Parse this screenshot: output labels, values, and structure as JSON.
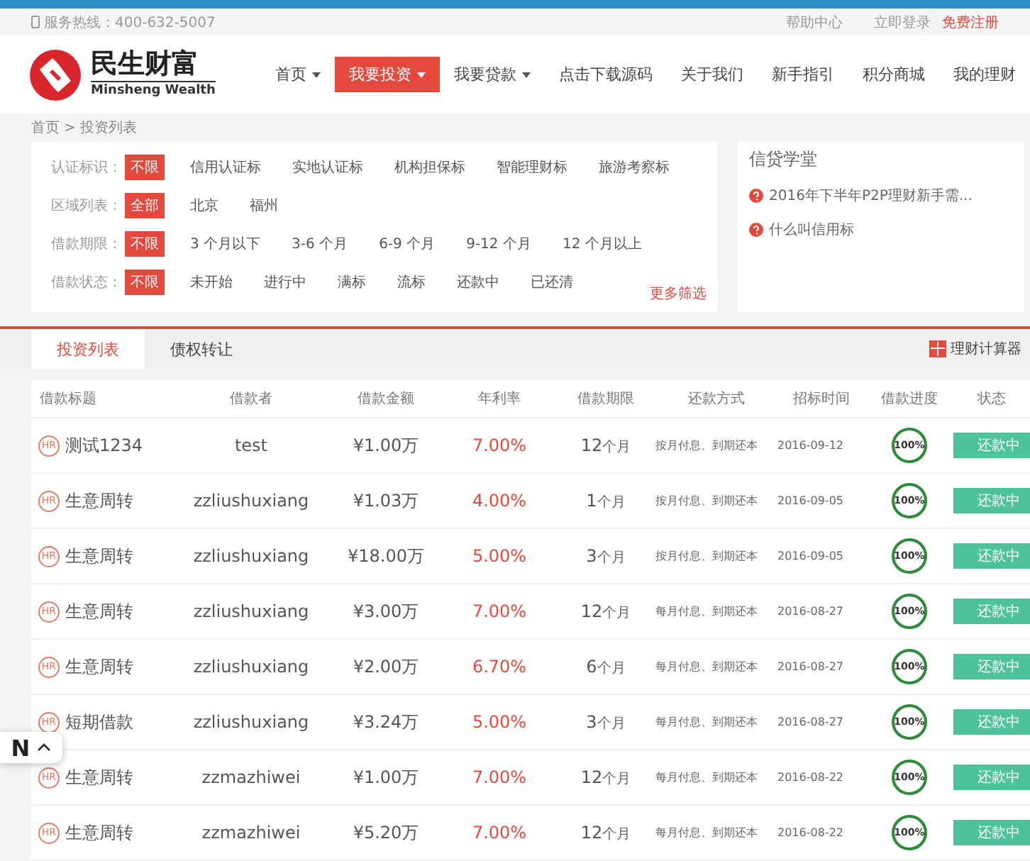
{
  "top_bar": {
    "hotline": "服务热线：400-632-5007",
    "links": [
      {
        "label": "帮助中心",
        "highlight": false
      },
      {
        "label": "立即登录",
        "highlight": false
      },
      {
        "label": "免费注册",
        "highlight": true
      }
    ]
  },
  "logo": {
    "name": "民生财富",
    "subtitle": "Minsheng Wealth"
  },
  "nav": [
    {
      "label": "首页",
      "selected": false,
      "has_menu": true
    },
    {
      "label": "我要投资",
      "selected": true,
      "has_menu": true
    },
    {
      "label": "我要贷款",
      "selected": false,
      "has_menu": true
    },
    {
      "label": "点击下载源码",
      "selected": false,
      "has_menu": false
    },
    {
      "label": "关于我们",
      "selected": false,
      "has_menu": false
    },
    {
      "label": "新手指引",
      "selected": false,
      "has_menu": false
    },
    {
      "label": "积分商城",
      "selected": false,
      "has_menu": false
    },
    {
      "label": "我的理财",
      "selected": false,
      "has_menu": false
    }
  ],
  "breadcrumb": {
    "items": [
      "首页",
      "投资列表"
    ],
    "separator": ">"
  },
  "filters": [
    {
      "label": "认证标识：",
      "options": [
        {
          "label": "不限",
          "selected": true
        },
        {
          "label": "信用认证标",
          "selected": false
        },
        {
          "label": "实地认证标",
          "selected": false
        },
        {
          "label": "机构担保标",
          "selected": false
        },
        {
          "label": "智能理财标",
          "selected": false
        },
        {
          "label": "旅游考察标",
          "selected": false
        }
      ]
    },
    {
      "label": "区域列表：",
      "options": [
        {
          "label": "全部",
          "selected": true
        },
        {
          "label": "北京",
          "selected": false
        },
        {
          "label": "福州",
          "selected": false
        }
      ]
    },
    {
      "label": "借款期限：",
      "options": [
        {
          "label": "不限",
          "selected": true
        },
        {
          "label": "3 个月以下",
          "selected": false
        },
        {
          "label": "3-6 个月",
          "selected": false
        },
        {
          "label": "6-9 个月",
          "selected": false
        },
        {
          "label": "9-12 个月",
          "selected": false
        },
        {
          "label": "12 个月以上",
          "selected": false
        }
      ]
    },
    {
      "label": "借款状态：",
      "options": [
        {
          "label": "不限",
          "selected": true
        },
        {
          "label": "未开始",
          "selected": false
        },
        {
          "label": "进行中",
          "selected": false
        },
        {
          "label": "满标",
          "selected": false
        },
        {
          "label": "流标",
          "selected": false
        },
        {
          "label": "还款中",
          "selected": false
        },
        {
          "label": "已还清",
          "selected": false
        }
      ]
    }
  ],
  "more_filters": "更多筛选",
  "school": {
    "title": "信贷学堂",
    "items": [
      "2016年下半年P2P理财新手需...",
      "什么叫信用标"
    ]
  },
  "tabs": [
    {
      "label": "投资列表",
      "selected": true
    },
    {
      "label": "债权转让",
      "selected": false
    }
  ],
  "calculator": "理财计算器",
  "table": {
    "columns": [
      "借款标题",
      "借款者",
      "借款金额",
      "年利率",
      "借款期限",
      "还款方式",
      "招标时间",
      "借款进度",
      "状态"
    ],
    "rows": [
      {
        "badge": "HR",
        "title": "测试1234",
        "borrower": "test",
        "amount": "¥1.00万",
        "rate": "7.00%",
        "period": "12",
        "unit": "个月",
        "repayment": "按月付息、到期还本",
        "date": "2016-09-12",
        "progress": "100%",
        "level": 1,
        "status": "还款中"
      },
      {
        "badge": "HR",
        "title": "生意周转",
        "borrower": "zzliushuxiang",
        "amount": "¥1.03万",
        "rate": "4.00%",
        "period": "1",
        "unit": "个月",
        "repayment": "按月付息、到期还本",
        "date": "2016-09-05",
        "progress": "100%",
        "level": 1,
        "status": "还款中"
      },
      {
        "badge": "HR",
        "title": "生意周转",
        "borrower": "zzliushuxiang",
        "amount": "¥18.00万",
        "rate": "5.00%",
        "period": "3",
        "unit": "个月",
        "repayment": "按月付息、到期还本",
        "date": "2016-09-05",
        "progress": "100%",
        "level": 1,
        "status": "还款中"
      },
      {
        "badge": "HR",
        "title": "生意周转",
        "borrower": "zzliushuxiang",
        "amount": "¥3.00万",
        "rate": "7.00%",
        "period": "12",
        "unit": "个月",
        "repayment": "每月付息、到期还本",
        "date": "2016-08-27",
        "progress": "100%",
        "level": 1,
        "status": "还款中"
      },
      {
        "badge": "HR",
        "title": "生意周转",
        "borrower": "zzliushuxiang",
        "amount": "¥2.00万",
        "rate": "6.70%",
        "period": "6",
        "unit": "个月",
        "repayment": "每月付息、到期还本",
        "date": "2016-08-27",
        "progress": "100%",
        "level": 1,
        "status": "还款中"
      },
      {
        "badge": "HR",
        "title": "短期借款",
        "borrower": "zzliushuxiang",
        "amount": "¥3.24万",
        "rate": "5.00%",
        "period": "3",
        "unit": "个月",
        "repayment": "每月付息、到期还本",
        "date": "2016-08-27",
        "progress": "100%",
        "level": 1,
        "status": "还款中"
      },
      {
        "badge": "HR",
        "title": "生意周转",
        "borrower": "zzmazhiwei",
        "amount": "¥1.00万",
        "rate": "7.00%",
        "period": "12",
        "unit": "个月",
        "repayment": "每月付息、到期还本",
        "date": "2016-08-22",
        "progress": "100%",
        "level": 1,
        "status": "还款中"
      },
      {
        "badge": "HR",
        "title": "生意周转",
        "borrower": "zzmazhiwei",
        "amount": "¥5.20万",
        "rate": "7.00%",
        "period": "12",
        "unit": "个月",
        "repayment": "每月付息、到期还本",
        "date": "2016-08-22",
        "progress": "100%",
        "level": 1,
        "status": "还款中"
      }
    ]
  },
  "floating_chip": {
    "label": "N"
  }
}
